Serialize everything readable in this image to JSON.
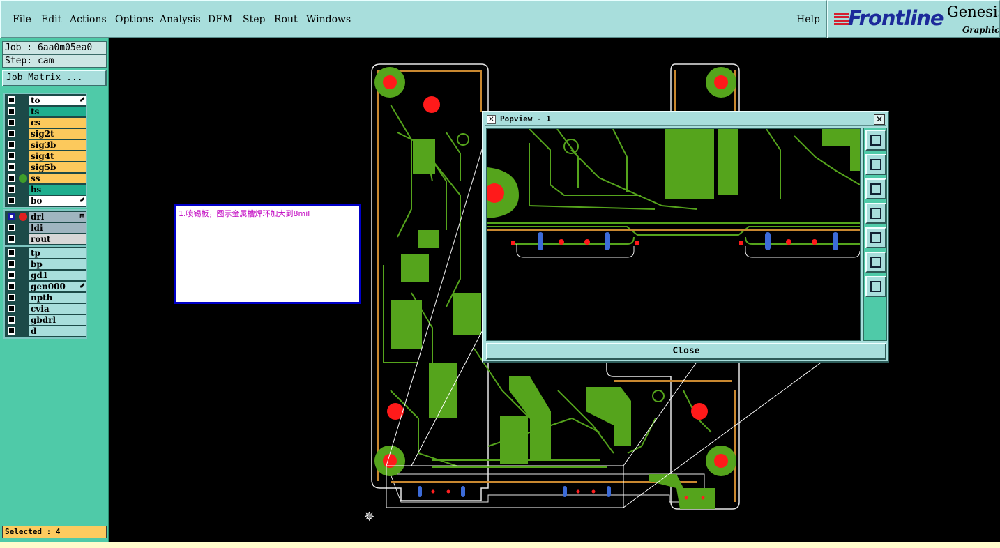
{
  "menubar": {
    "items": [
      "File",
      "Edit",
      "Actions",
      "Options",
      "Analysis",
      "DFM",
      "Step",
      "Rout",
      "Windows"
    ],
    "help": "Help"
  },
  "logo": {
    "word": "Frontline",
    "product": "Genesis",
    "subtitle": "Graphic"
  },
  "left_panel": {
    "job": "Job : 6aa0m05ea0",
    "step": "Step: cam",
    "matrix_button": "Job Matrix ...",
    "layer_groups": [
      [
        {
          "name": "to",
          "color": "#ffffff",
          "tag": "⬋"
        },
        {
          "name": "ts",
          "color": "#1fae8e"
        },
        {
          "name": "cs",
          "color": "#fcc95c"
        },
        {
          "name": "sig2t",
          "color": "#fcc95c"
        },
        {
          "name": "sig3b",
          "color": "#fcc95c"
        },
        {
          "name": "sig4t",
          "color": "#fcc95c"
        },
        {
          "name": "sig5b",
          "color": "#fcc95c"
        },
        {
          "name": "ss",
          "color": "#fcc95c",
          "dot": "#3f9d2a"
        },
        {
          "name": "bs",
          "color": "#1fae8e"
        },
        {
          "name": "bo",
          "color": "#ffffff",
          "tag": "⬋"
        }
      ],
      [
        {
          "name": "drl",
          "color": "#9fb5c0",
          "selected": true,
          "dot": "#e02020",
          "tag": "⊞"
        },
        {
          "name": "ldi",
          "color": "#9fb5c0"
        },
        {
          "name": "rout",
          "color": "#d7d7d7"
        }
      ],
      [
        {
          "name": "tp",
          "color": "#a8dedc"
        },
        {
          "name": "bp",
          "color": "#a8dedc"
        },
        {
          "name": "gd1",
          "color": "#a8dedc"
        },
        {
          "name": "gen000",
          "color": "#a8dedc",
          "tag": "⬋"
        },
        {
          "name": "npth",
          "color": "#a8dedc"
        },
        {
          "name": "cvia",
          "color": "#a8dedc"
        },
        {
          "name": "gbdrl",
          "color": "#a8dedc"
        },
        {
          "name": "d",
          "color": "#a8dedc"
        }
      ]
    ],
    "status": "Selected : 4"
  },
  "note": {
    "text": "1.喷锡板，图示金属槽焊环加大到8mil"
  },
  "popview": {
    "title": "Popview - 1",
    "close_label": "Close",
    "tools": [
      "zoom-window-icon",
      "pan-up-icon",
      "pan-down-icon",
      "pan-left-icon",
      "pan-right-icon",
      "zoom-out-icon",
      "zoom-in-icon"
    ]
  },
  "colors": {
    "board_green": "#55a41c",
    "pad_red": "#ff1a1a",
    "accent_teal": "#4fcaa8",
    "panel_light": "#a8dedc",
    "highlight_orange": "#fcc95c"
  }
}
